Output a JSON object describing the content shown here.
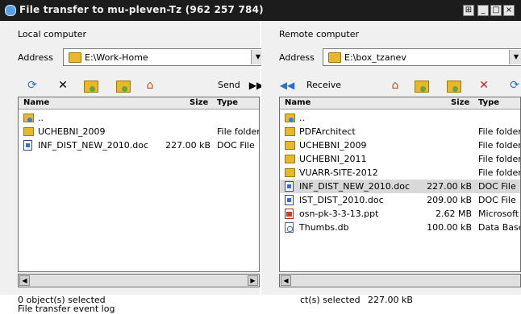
{
  "window": {
    "title": "File transfer to mu-pleven-Tz (962 257 784)",
    "controls": [
      "⊞",
      "_",
      "□",
      "×"
    ]
  },
  "local": {
    "label": "Local computer",
    "address_label": "Address",
    "address_value": "E:\\Work-Home",
    "send_label": "Send",
    "columns": [
      "Name",
      "Size",
      "Type"
    ],
    "rows": [
      {
        "icon": "up",
        "name": "..",
        "size": "",
        "type": ""
      },
      {
        "icon": "folder",
        "name": "UCHEBNI_2009",
        "size": "",
        "type": "File folder"
      },
      {
        "icon": "doc",
        "name": "INF_DIST_NEW_2010.doc",
        "size": "227.00 kB",
        "type": "DOC File"
      }
    ],
    "status": "0 object(s) selected"
  },
  "remote": {
    "label": "Remote computer",
    "address_label": "Address",
    "address_value": "E:\\box_tzanev",
    "receive_label": "Receive",
    "columns": [
      "Name",
      "Size",
      "Type"
    ],
    "rows": [
      {
        "icon": "up",
        "name": "..",
        "size": "",
        "type": ""
      },
      {
        "icon": "folder",
        "name": "PDFArchitect",
        "size": "",
        "type": "File folder"
      },
      {
        "icon": "folder",
        "name": "UCHEBNI_2009",
        "size": "",
        "type": "File folder"
      },
      {
        "icon": "folder",
        "name": "UCHEBNI_2011",
        "size": "",
        "type": "File folder"
      },
      {
        "icon": "folder",
        "name": "VUARR-SITE-2012",
        "size": "",
        "type": "File folder"
      },
      {
        "icon": "doc",
        "name": "INF_DIST_NEW_2010.doc",
        "size": "227.00 kB",
        "type": "DOC File",
        "selected": true
      },
      {
        "icon": "doc",
        "name": "IST_DIST_2010.doc",
        "size": "209.00 kB",
        "type": "DOC File"
      },
      {
        "icon": "ppt",
        "name": "osn-pk-3-3-13.ppt",
        "size": "2.62 MB",
        "type": "Microsoft Po"
      },
      {
        "icon": "db",
        "name": "Thumbs.db",
        "size": "100.00 kB",
        "type": "Data Base F"
      }
    ],
    "status_text": "ct(s) selected",
    "status_size": "227.00 kB"
  },
  "log_label": "File transfer event log"
}
